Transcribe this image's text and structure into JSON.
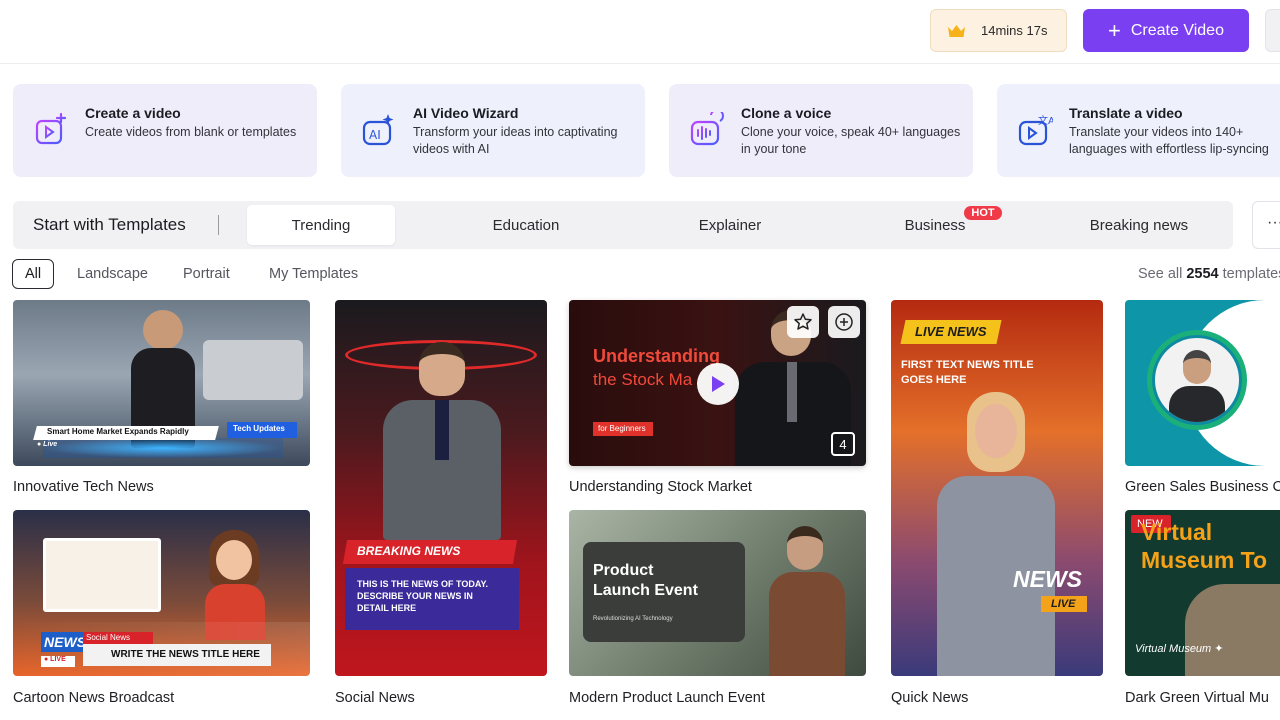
{
  "header": {
    "timer": "14mins 17s",
    "create_label": "Create Video",
    "crown_icon": "crown-icon",
    "accent": "#7b3ff2"
  },
  "features": [
    {
      "title": "Create a video",
      "desc": "Create videos from blank or templates",
      "icon": "video-plus-icon",
      "bg": "#f0edfb"
    },
    {
      "title": "AI Video Wizard",
      "desc": "Transform your ideas into captivating videos with AI",
      "icon": "ai-wizard-icon",
      "bg": "#eef1fb"
    },
    {
      "title": "Clone a voice",
      "desc": "Clone your voice, speak 40+ languages in your tone",
      "icon": "voice-clone-icon",
      "bg": "#f0edfb"
    },
    {
      "title": "Translate a video",
      "desc": "Translate your videos into 140+ languages with effortless lip-syncing",
      "icon": "translate-video-icon",
      "bg": "#eef1fb"
    }
  ],
  "categories": {
    "title": "Start with Templates",
    "tabs": [
      "Trending",
      "Education",
      "Explainer",
      "Business",
      "Breaking news"
    ],
    "active": "Trending",
    "hot_badge": "HOT",
    "more": "···"
  },
  "filters": [
    "All",
    "Landscape",
    "Portrait",
    "My Templates"
  ],
  "see_all": {
    "prefix": "See all",
    "count": "2554",
    "suffix": "templates"
  },
  "templates": [
    {
      "name": "Innovative Tech News",
      "banner": "Smart Home Market Expands Rapidly",
      "tag": "Tech Updates",
      "live": "● Live"
    },
    {
      "name": "Cartoon News Broadcast",
      "news": "NEWS",
      "social": "Social News",
      "headline": "WRITE THE NEWS TITLE HERE",
      "live": "● LIVE"
    },
    {
      "name": "Social News",
      "breaking": "BREAKING NEWS",
      "body": "THIS IS THE  NEWS OF TODAY. DESCRIBE YOUR NEWS IN DETAIL HERE"
    },
    {
      "name": "Understanding Stock Market",
      "title1": "Understanding",
      "title2": "the Stock Ma",
      "tag": "for Beginners",
      "count": "4"
    },
    {
      "name": "Modern Product Launch Event",
      "title1": "Product",
      "title2": "Launch Event",
      "sub": "Revolutionizing AI Technology"
    },
    {
      "name": "Quick News",
      "live_news": "LIVE NEWS",
      "headline": "FIRST TEXT NEWS TITLE GOES HERE",
      "news": "NEWS",
      "live": "LIVE"
    },
    {
      "name": "Green Sales Business Ca"
    },
    {
      "name": "Dark Green Virtual Mu",
      "new_badge": "NEW",
      "title": "Virtual Museum To",
      "script": "Virtual Museum ✦"
    }
  ]
}
